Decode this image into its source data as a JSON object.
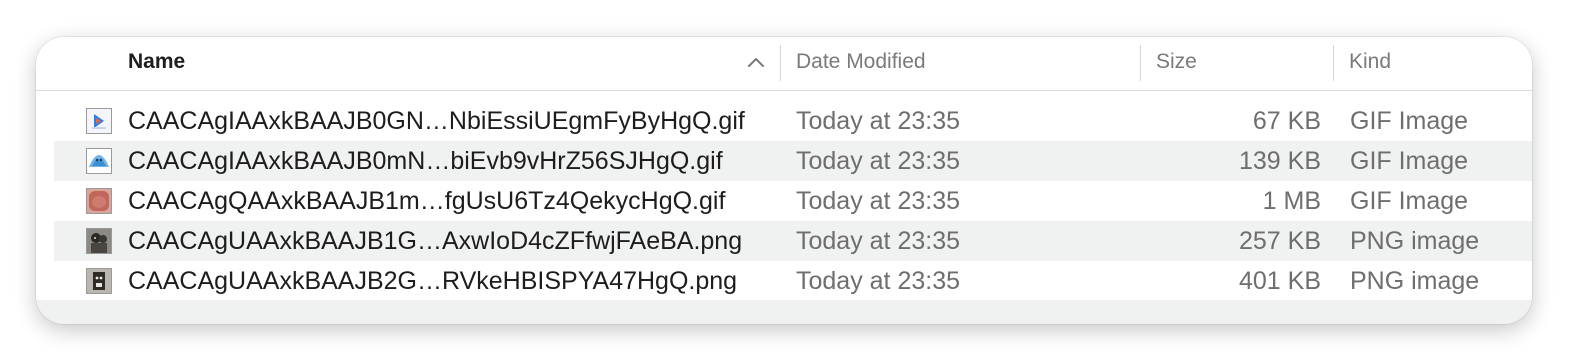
{
  "columns": {
    "name": "Name",
    "date": "Date Modified",
    "size": "Size",
    "kind": "Kind"
  },
  "sort": {
    "column": "name",
    "direction": "ascending",
    "icon": "chevron-up-icon"
  },
  "files": [
    {
      "name": "CAACAgIAAxkBAAJB0GN…NbiEssiUEgmFyByHgQ.gif",
      "date": "Today at 23:35",
      "size": "67 KB",
      "kind": "GIF Image",
      "thumb": "gif-thumbnail-icon"
    },
    {
      "name": "CAACAgIAAxkBAAJB0mN…biEvb9vHrZ56SJHgQ.gif",
      "date": "Today at 23:35",
      "size": "139 KB",
      "kind": "GIF Image",
      "thumb": "gif-thumbnail-icon"
    },
    {
      "name": "CAACAgQAAxkBAAJB1m…fgUsU6Tz4QekycHgQ.gif",
      "date": "Today at 23:35",
      "size": "1 MB",
      "kind": "GIF Image",
      "thumb": "gif-thumbnail-icon"
    },
    {
      "name": "CAACAgUAAxkBAAJB1G…AxwIoD4cZFfwjFAeBA.png",
      "date": "Today at 23:35",
      "size": "257 KB",
      "kind": "PNG image",
      "thumb": "png-thumbnail-icon"
    },
    {
      "name": "CAACAgUAAxkBAAJB2G…RVkeHBISPYA47HgQ.png",
      "date": "Today at 23:35",
      "size": "401 KB",
      "kind": "PNG image",
      "thumb": "png-thumbnail-icon"
    }
  ],
  "colors": {
    "alt_row": "#f0f1f1",
    "header_divider": "#d6d6d6"
  }
}
